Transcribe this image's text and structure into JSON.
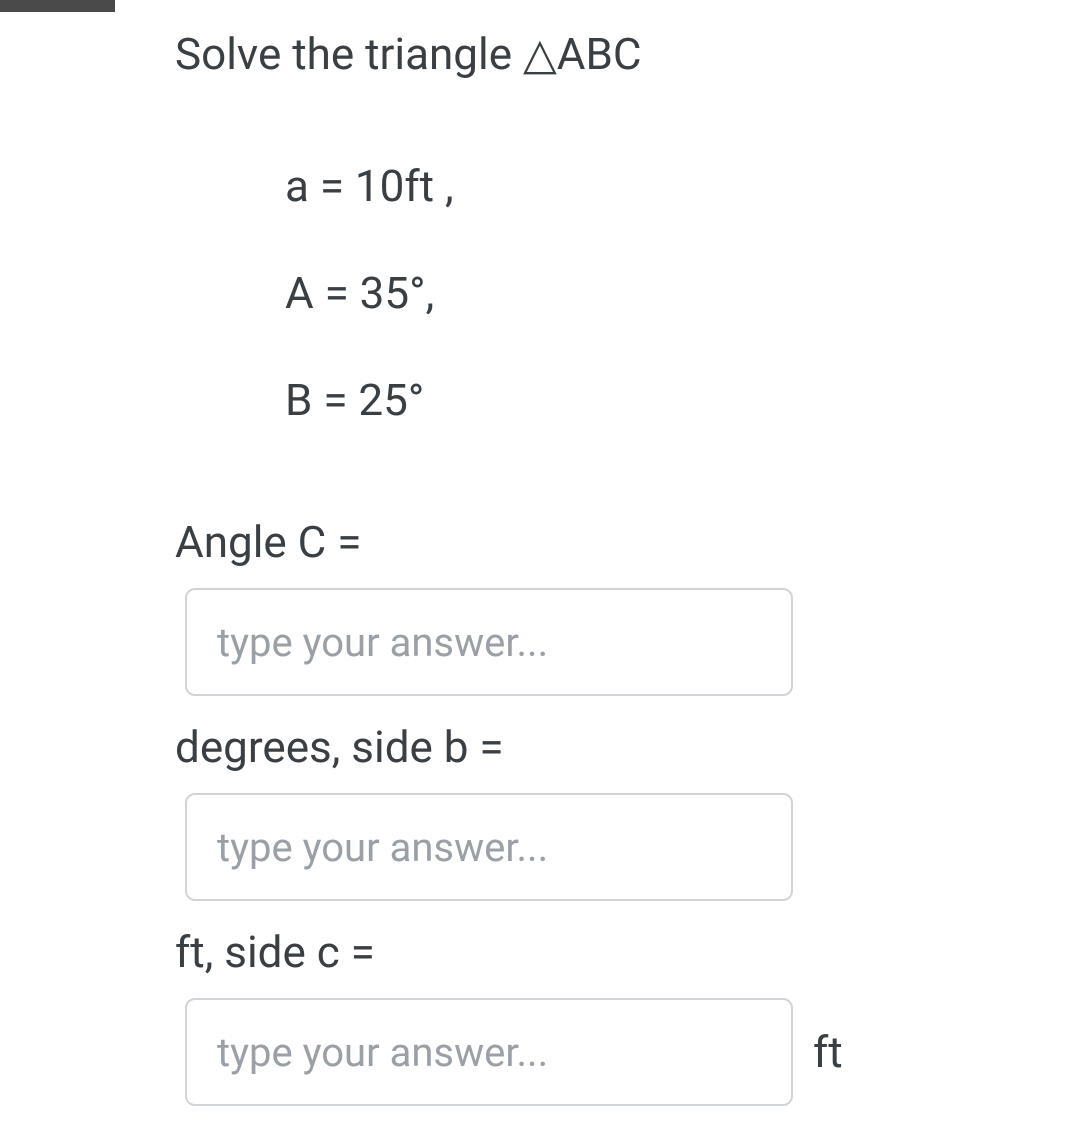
{
  "title_prefix": "Solve the triangle ",
  "triangle_label": "△ABC",
  "given": {
    "line1": "a = 10ft ,",
    "line2": "A = 35°,",
    "line3": "B = 25°"
  },
  "labels": {
    "angle_c": "Angle C =",
    "degrees_side_b": "degrees, side b =",
    "ft_side_c": "ft, side c ="
  },
  "inputs": {
    "placeholder": "type your answer..."
  },
  "units": {
    "ft": "ft"
  }
}
